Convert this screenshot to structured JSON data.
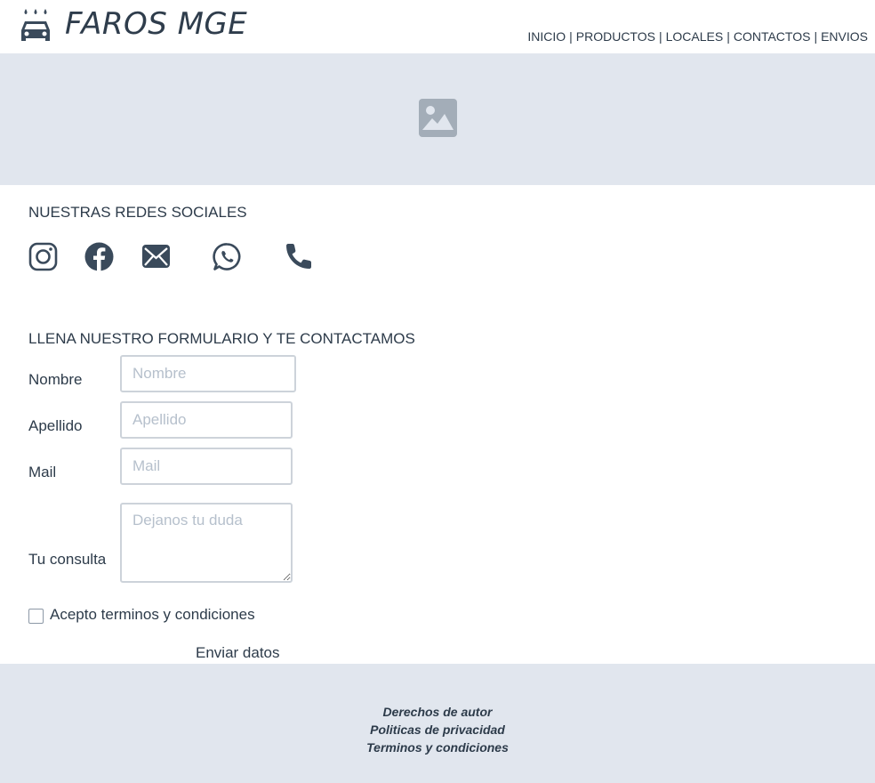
{
  "header": {
    "brand": "FAROS MGE",
    "logo_icon": "car-wash-icon",
    "nav": [
      {
        "label": "INICIO"
      },
      {
        "label": "PRODUCTOS"
      },
      {
        "label": "LOCALES"
      },
      {
        "label": "CONTACTOS"
      },
      {
        "label": "ENVIOS"
      }
    ],
    "nav_separator": "|"
  },
  "banner": {
    "icon": "image-placeholder-icon"
  },
  "social": {
    "title": "NUESTRAS REDES SOCIALES",
    "icons": [
      "instagram-icon",
      "facebook-icon",
      "mail-icon",
      "whatsapp-icon",
      "phone-icon"
    ]
  },
  "form": {
    "title": "LLENA NUESTRO FORMULARIO Y TE CONTACTAMOS",
    "fields": {
      "nombre": {
        "label": "Nombre",
        "placeholder": "Nombre",
        "value": ""
      },
      "apellido": {
        "label": "Apellido",
        "placeholder": "Apellido",
        "value": ""
      },
      "mail": {
        "label": "Mail",
        "placeholder": "Mail",
        "value": ""
      },
      "consulta": {
        "label": "Tu consulta",
        "placeholder": "Dejanos tu duda",
        "value": ""
      }
    },
    "terms_label": "Acepto terminos y condiciones",
    "terms_checked": false,
    "submit_label": "Enviar datos"
  },
  "footer": {
    "links": [
      "Derechos de autor",
      "Politicas de privacidad",
      "Terminos y condiciones"
    ]
  },
  "colors": {
    "text": "#2d3b4a",
    "banner_bg": "#e1e6ee",
    "placeholder": "#b6c0cc",
    "field_border": "#cdd3da"
  }
}
